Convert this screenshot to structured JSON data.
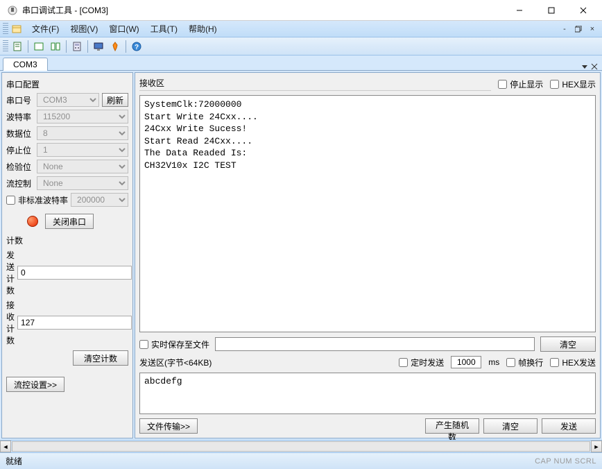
{
  "window": {
    "title": "串口调试工具 - [COM3]",
    "tab": "COM3"
  },
  "menu": {
    "file": "文件(F)",
    "view": "视图(V)",
    "window": "窗口(W)",
    "tools": "工具(T)",
    "help": "帮助(H)"
  },
  "left": {
    "group_title": "串口配置",
    "port_lbl": "串口号",
    "port_val": "COM3",
    "refresh": "刷新",
    "baud_lbl": "波特率",
    "baud_val": "115200",
    "data_lbl": "数据位",
    "data_val": "8",
    "stop_lbl": "停止位",
    "stop_val": "1",
    "parity_lbl": "检验位",
    "parity_val": "None",
    "flow_lbl": "流控制",
    "flow_val": "None",
    "nonstd_lbl": "非标准波特率",
    "nonstd_val": "200000",
    "close_port": "关闭串口",
    "count_group": "计数",
    "send_count_lbl": "发送计数",
    "send_count_val": "0",
    "recv_count_lbl": "接收计数",
    "recv_count_val": "127",
    "clear_count": "清空计数",
    "flow_settings": "流控设置>>"
  },
  "rx": {
    "title": "接收区",
    "pause_lbl": "停止显示",
    "hex_lbl": "HEX显示",
    "content": "SystemClk:72000000\nStart Write 24Cxx....\n24Cxx Write Sucess!\nStart Read 24Cxx....\nThe Data Readed Is:\nCH32V10x I2C TEST"
  },
  "rt": {
    "save_lbl": "实时保存至文件",
    "clear": "清空"
  },
  "tx": {
    "title": "发送区(字节<64KB)",
    "timed_lbl": "定时发送",
    "interval": "1000",
    "ms": "ms",
    "wrap_lbl": "帧换行",
    "hex_lbl": "HEX发送",
    "content": "abcdefg",
    "file_transfer": "文件传输>>",
    "rand": "产生随机数",
    "clear": "清空",
    "send": "发送"
  },
  "status": {
    "ready": "就绪",
    "indicators": "CAP NUM SCRL"
  }
}
